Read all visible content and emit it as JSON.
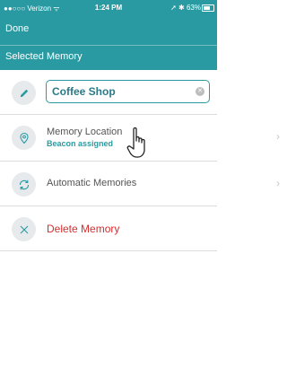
{
  "status_bar": {
    "carrier": "●●○○○ Verizon ᯤ",
    "time": "1:24 PM",
    "right": "➚ ✱ 63%"
  },
  "nav": {
    "done_label": "Done"
  },
  "section": {
    "title": "Selected Memory"
  },
  "memory": {
    "name": "Coffee Shop"
  },
  "rows": [
    {
      "label": "Memory Location",
      "subtitle": "Beacon assigned"
    },
    {
      "label": "Automatic Memories"
    },
    {
      "label": "Delete Memory"
    }
  ],
  "colors": {
    "accent": "#2a9aa2",
    "destructive": "#d72d2d"
  }
}
